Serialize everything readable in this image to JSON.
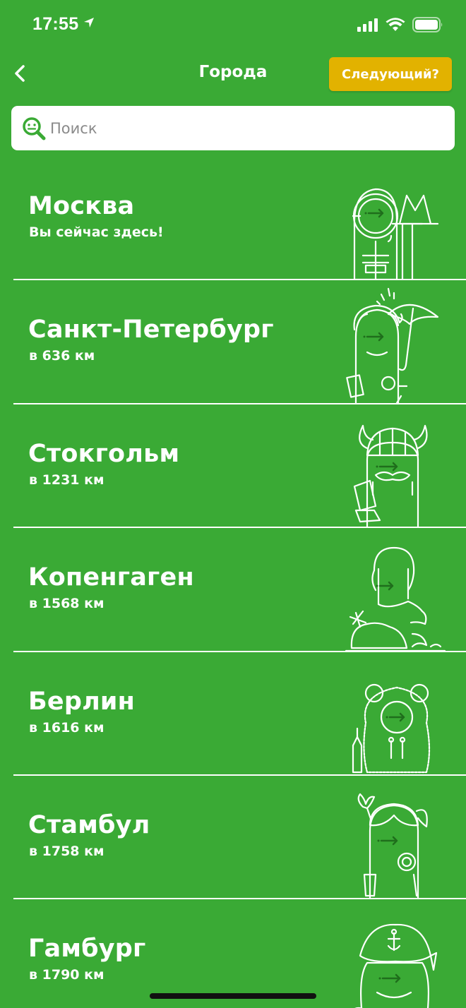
{
  "status_bar": {
    "time": "17:55"
  },
  "nav": {
    "title": "Города",
    "next_label": "Следующий?"
  },
  "search": {
    "placeholder": "Поиск"
  },
  "cities": [
    {
      "name": "Москва",
      "subtitle": "Вы сейчас здесь!",
      "mascot": "cosmonaut-metro"
    },
    {
      "name": "Санкт-Петербург",
      "subtitle": "в 636 км",
      "mascot": "umbrella-rain"
    },
    {
      "name": "Стокгольм",
      "subtitle": "в 1231 км",
      "mascot": "viking-helmet"
    },
    {
      "name": "Копенгаген",
      "subtitle": "в 1568 км",
      "mascot": "little-mermaid"
    },
    {
      "name": "Берлин",
      "subtitle": "в 1616 км",
      "mascot": "bear"
    },
    {
      "name": "Стамбул",
      "subtitle": "в 1758 км",
      "mascot": "tulip-girl"
    },
    {
      "name": "Гамбург",
      "subtitle": "в 1790 км",
      "mascot": "sailor"
    }
  ],
  "colors": {
    "background": "#3aaa35",
    "accent_button": "#e2b200",
    "mascot_arrow": "#1f6e1c"
  }
}
